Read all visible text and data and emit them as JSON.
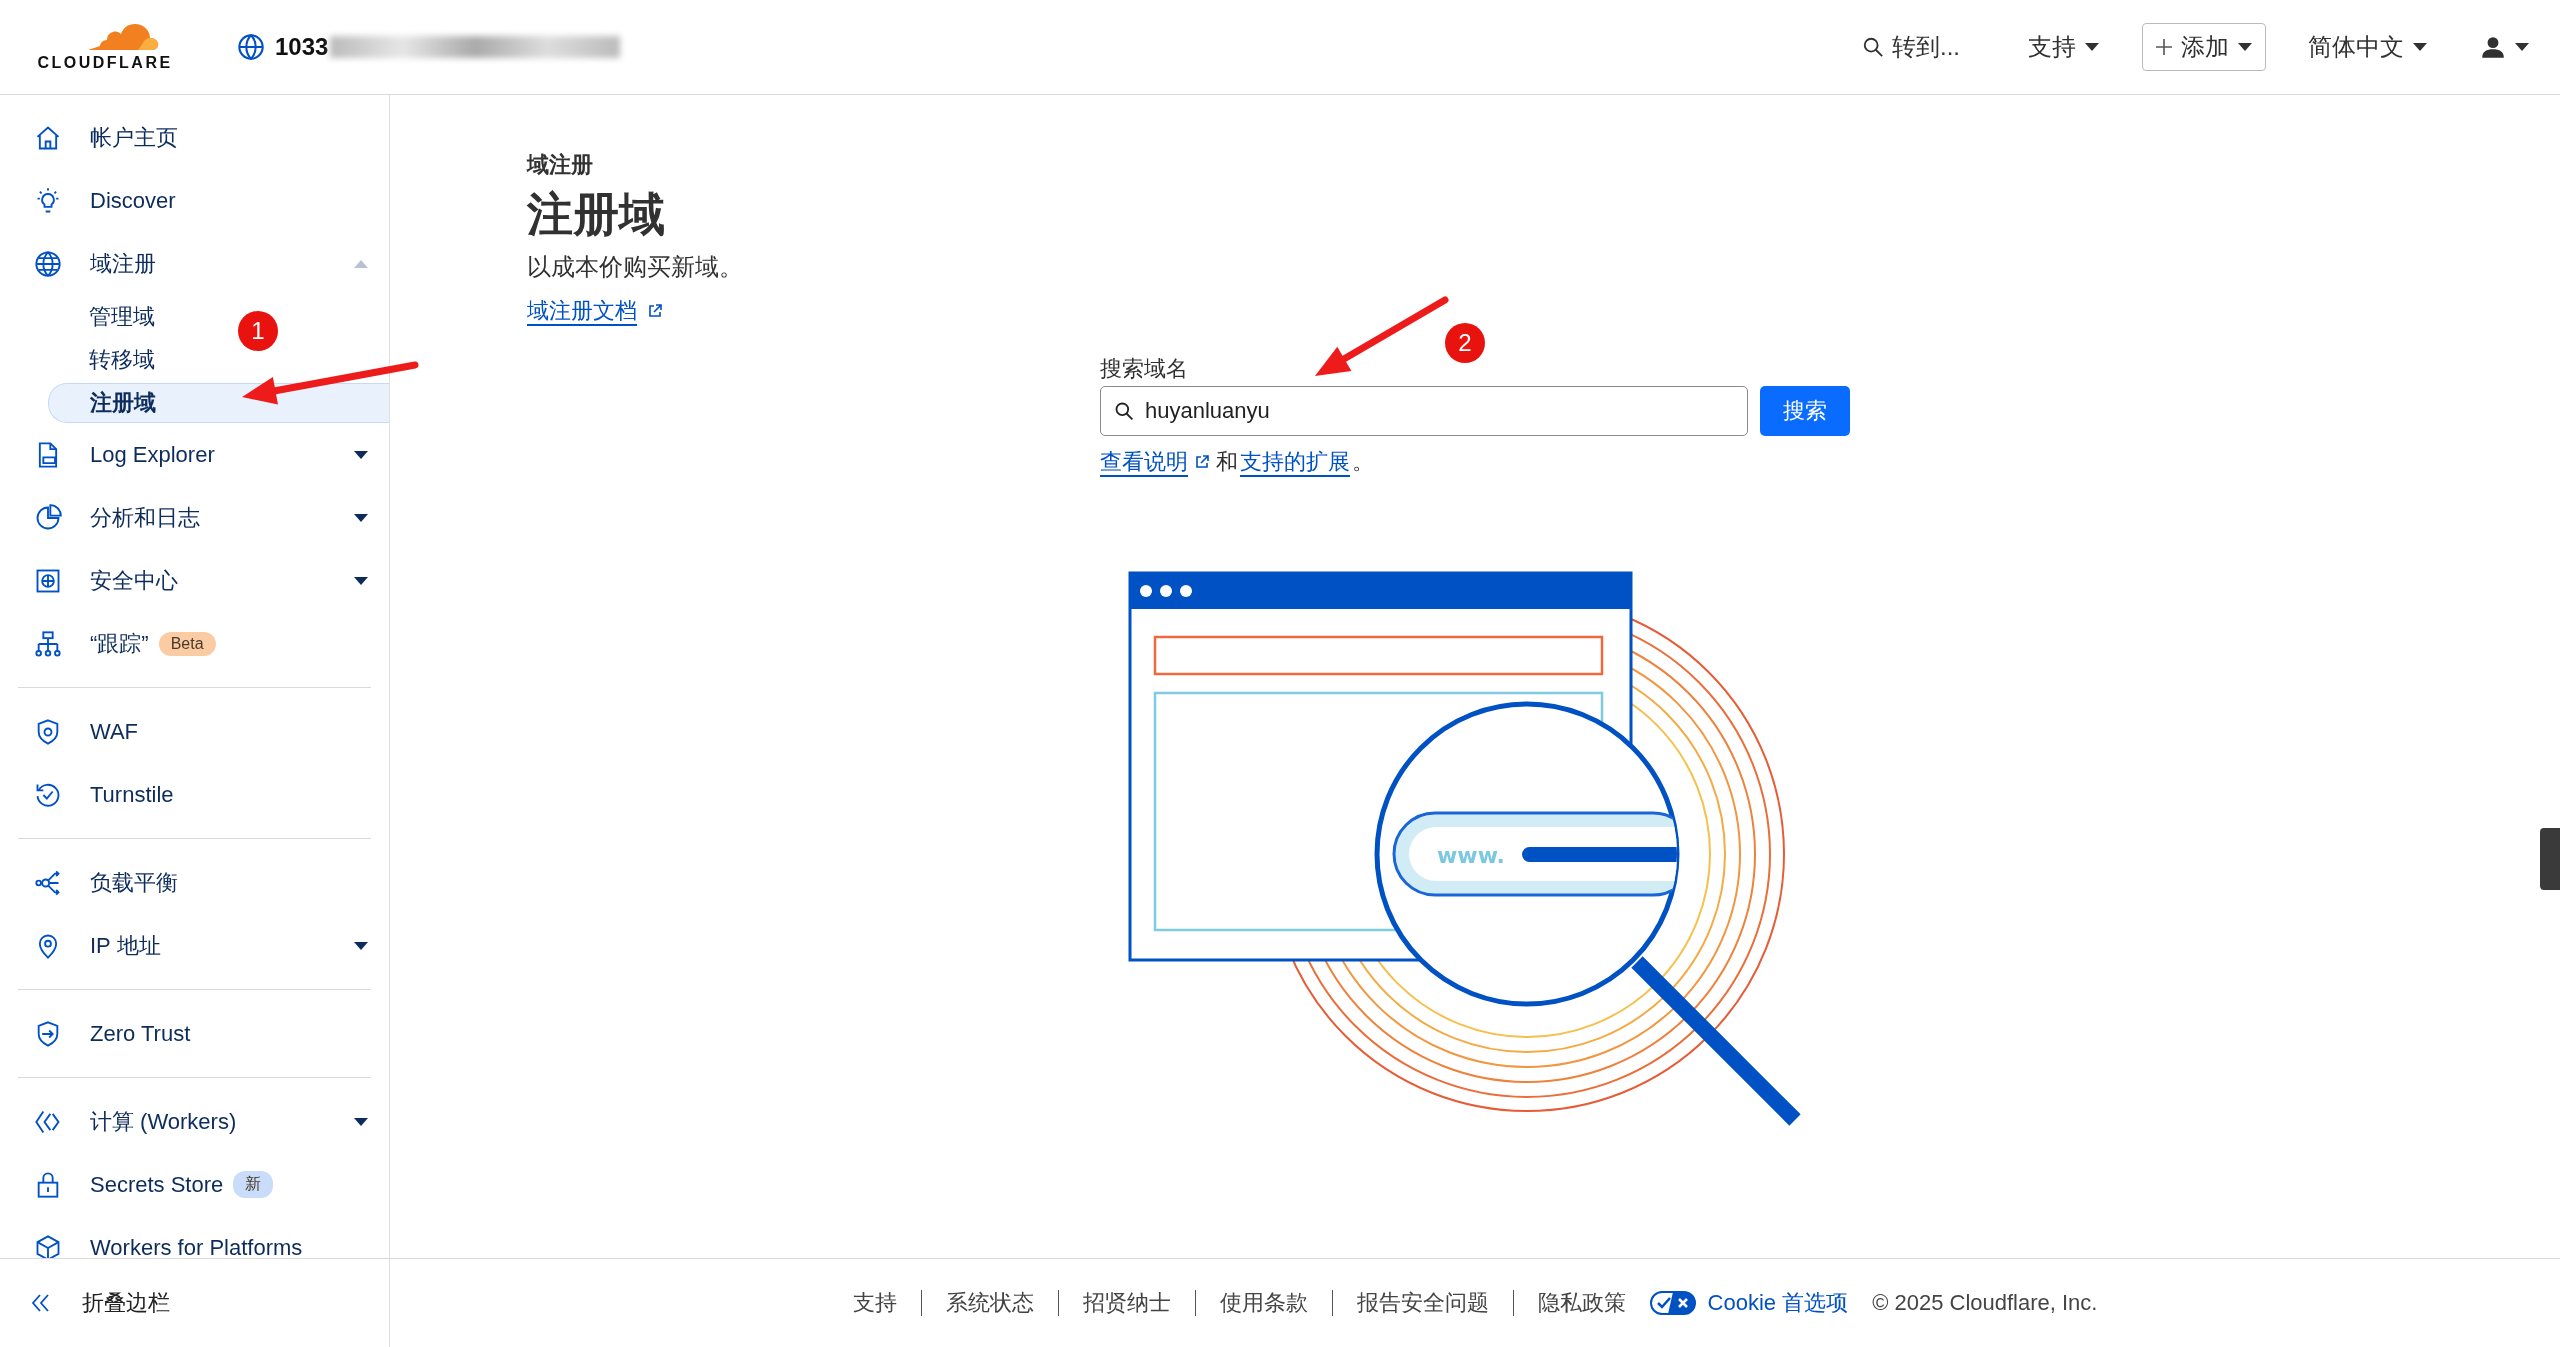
{
  "header": {
    "logo_text": "CLOUDFLARE",
    "account": "1033",
    "goto": "转到...",
    "menus": [
      {
        "label": "支持",
        "kind": "dropdown"
      },
      {
        "label": "添加",
        "kind": "add"
      },
      {
        "label": "简体中文",
        "kind": "dropdown"
      }
    ]
  },
  "sidebar": {
    "groups": [
      {
        "items": [
          {
            "label": "帐户主页"
          },
          {
            "label": "Discover"
          },
          {
            "label": "域注册",
            "expanded": true,
            "children": [
              {
                "label": "管理域",
                "selected": false
              },
              {
                "label": "转移域",
                "selected": false
              },
              {
                "label": "注册域",
                "selected": true
              }
            ]
          },
          {
            "label": "Log Explorer",
            "expanded": false
          },
          {
            "label": "分析和日志",
            "expanded": false
          },
          {
            "label": "安全中心",
            "expanded": false
          },
          {
            "label": "“跟踪”",
            "badge": {
              "text": "Beta",
              "color": "#fbcba4"
            }
          }
        ]
      },
      {
        "items": [
          {
            "label": "WAF"
          },
          {
            "label": "Turnstile"
          }
        ]
      },
      {
        "items": [
          {
            "label": "负载平衡"
          },
          {
            "label": "IP 地址",
            "expanded": false
          }
        ]
      },
      {
        "items": [
          {
            "label": "Zero Trust"
          }
        ]
      },
      {
        "items": [
          {
            "label": "计算 (Workers)",
            "expanded": false
          },
          {
            "label": "Secrets Store",
            "badge": {
              "text": "新",
              "color": "#c9ddfb"
            }
          },
          {
            "label": "Workers for Platforms"
          }
        ]
      }
    ],
    "collapse": "折叠边栏"
  },
  "main": {
    "breadcrumb": "域注册",
    "title": "注册域",
    "subtitle": "以成本价购买新域。",
    "doc_link": "域注册文档",
    "search": {
      "label": "搜索域名",
      "value": "huyanluanyu",
      "button": "搜索"
    },
    "help": [
      {
        "kind": "link",
        "text": "查看说明",
        "external": true
      },
      {
        "kind": "text",
        "text": "和"
      },
      {
        "kind": "link",
        "text": "支持的扩展",
        "external": false
      },
      {
        "kind": "text",
        "text": "。"
      }
    ],
    "illustration": {
      "url_prefix": "www."
    }
  },
  "footer": {
    "links": [
      "支持",
      "系统状态",
      "招贤纳士",
      "使用条款",
      "报告安全问题",
      "隐私政策"
    ],
    "cookie": "Cookie 首选项",
    "copyright": "© 2025 Cloudflare, Inc."
  },
  "annotations": [
    {
      "number": "1"
    },
    {
      "number": "2"
    }
  ]
}
